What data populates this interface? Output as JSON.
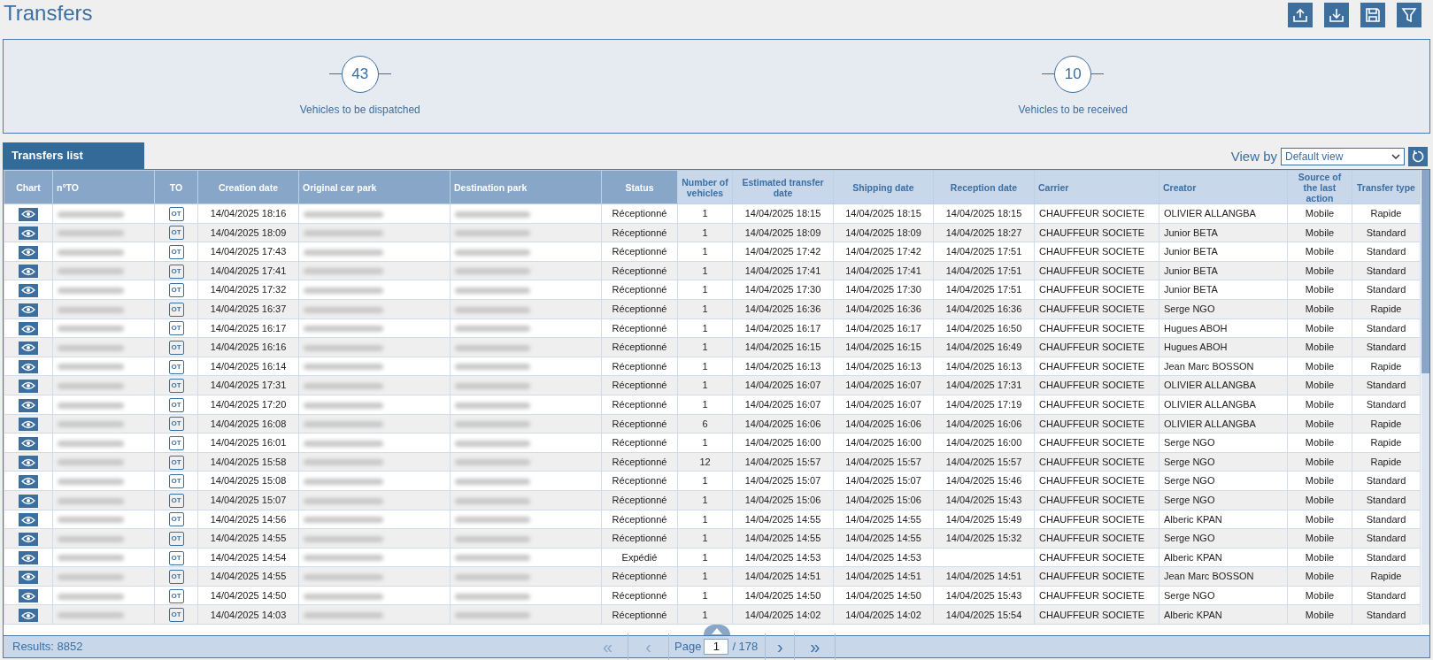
{
  "title": "Transfers",
  "summary": [
    {
      "count": "43",
      "label": "Vehicles to be dispatched"
    },
    {
      "count": "10",
      "label": "Vehicles to be received"
    }
  ],
  "list_tab": {
    "label": "Transfers list",
    "selected": true
  },
  "view_by": {
    "label": "View by",
    "value": "Default view"
  },
  "columns": [
    "Chart",
    "n°TO",
    "TO",
    "Creation date",
    "Original car park",
    "Destination park",
    "Status",
    "Number of vehicles",
    "Estimated transfer date",
    "Shipping date",
    "Reception date",
    "Carrier",
    "Creator",
    "Source of the last action",
    "Transfer type"
  ],
  "rows": [
    {
      "to_label": "OT",
      "creation": "14/04/2025 18:16",
      "status": "Réceptionné",
      "vehicles": "1",
      "estimated": "14/04/2025 18:15",
      "shipping": "14/04/2025 18:15",
      "reception": "14/04/2025 18:15",
      "carrier": "CHAUFFEUR SOCIETE",
      "creator": "OLIVIER ALLANGBA",
      "source": "Mobile",
      "type": "Rapide"
    },
    {
      "to_label": "OT",
      "creation": "14/04/2025 18:09",
      "status": "Réceptionné",
      "vehicles": "1",
      "estimated": "14/04/2025 18:09",
      "shipping": "14/04/2025 18:09",
      "reception": "14/04/2025 18:27",
      "carrier": "CHAUFFEUR SOCIETE",
      "creator": "Junior BETA",
      "source": "Mobile",
      "type": "Standard"
    },
    {
      "to_label": "OT",
      "creation": "14/04/2025 17:43",
      "status": "Réceptionné",
      "vehicles": "1",
      "estimated": "14/04/2025 17:42",
      "shipping": "14/04/2025 17:42",
      "reception": "14/04/2025 17:51",
      "carrier": "CHAUFFEUR SOCIETE",
      "creator": "Junior BETA",
      "source": "Mobile",
      "type": "Standard"
    },
    {
      "to_label": "OT",
      "creation": "14/04/2025 17:41",
      "status": "Réceptionné",
      "vehicles": "1",
      "estimated": "14/04/2025 17:41",
      "shipping": "14/04/2025 17:41",
      "reception": "14/04/2025 17:51",
      "carrier": "CHAUFFEUR SOCIETE",
      "creator": "Junior BETA",
      "source": "Mobile",
      "type": "Standard"
    },
    {
      "to_label": "OT",
      "creation": "14/04/2025 17:32",
      "status": "Réceptionné",
      "vehicles": "1",
      "estimated": "14/04/2025 17:30",
      "shipping": "14/04/2025 17:30",
      "reception": "14/04/2025 17:51",
      "carrier": "CHAUFFEUR SOCIETE",
      "creator": "Junior BETA",
      "source": "Mobile",
      "type": "Standard"
    },
    {
      "to_label": "OT",
      "creation": "14/04/2025 16:37",
      "status": "Réceptionné",
      "vehicles": "1",
      "estimated": "14/04/2025 16:36",
      "shipping": "14/04/2025 16:36",
      "reception": "14/04/2025 16:36",
      "carrier": "CHAUFFEUR SOCIETE",
      "creator": "Serge NGO",
      "source": "Mobile",
      "type": "Rapide"
    },
    {
      "to_label": "OT",
      "creation": "14/04/2025 16:17",
      "status": "Réceptionné",
      "vehicles": "1",
      "estimated": "14/04/2025 16:17",
      "shipping": "14/04/2025 16:17",
      "reception": "14/04/2025 16:50",
      "carrier": "CHAUFFEUR SOCIETE",
      "creator": "Hugues ABOH",
      "source": "Mobile",
      "type": "Standard"
    },
    {
      "to_label": "OT",
      "creation": "14/04/2025 16:16",
      "status": "Réceptionné",
      "vehicles": "1",
      "estimated": "14/04/2025 16:15",
      "shipping": "14/04/2025 16:15",
      "reception": "14/04/2025 16:49",
      "carrier": "CHAUFFEUR SOCIETE",
      "creator": "Hugues ABOH",
      "source": "Mobile",
      "type": "Standard"
    },
    {
      "to_label": "OT",
      "creation": "14/04/2025 16:14",
      "status": "Réceptionné",
      "vehicles": "1",
      "estimated": "14/04/2025 16:13",
      "shipping": "14/04/2025 16:13",
      "reception": "14/04/2025 16:13",
      "carrier": "CHAUFFEUR SOCIETE",
      "creator": "Jean Marc BOSSON",
      "source": "Mobile",
      "type": "Rapide"
    },
    {
      "to_label": "OT",
      "creation": "14/04/2025 17:31",
      "status": "Réceptionné",
      "vehicles": "1",
      "estimated": "14/04/2025 16:07",
      "shipping": "14/04/2025 16:07",
      "reception": "14/04/2025 17:31",
      "carrier": "CHAUFFEUR SOCIETE",
      "creator": "OLIVIER ALLANGBA",
      "source": "Mobile",
      "type": "Standard"
    },
    {
      "to_label": "OT",
      "creation": "14/04/2025 17:20",
      "status": "Réceptionné",
      "vehicles": "1",
      "estimated": "14/04/2025 16:07",
      "shipping": "14/04/2025 16:07",
      "reception": "14/04/2025 17:19",
      "carrier": "CHAUFFEUR SOCIETE",
      "creator": "OLIVIER ALLANGBA",
      "source": "Mobile",
      "type": "Standard"
    },
    {
      "to_label": "OT",
      "creation": "14/04/2025 16:08",
      "status": "Réceptionné",
      "vehicles": "6",
      "estimated": "14/04/2025 16:06",
      "shipping": "14/04/2025 16:06",
      "reception": "14/04/2025 16:06",
      "carrier": "CHAUFFEUR SOCIETE",
      "creator": "OLIVIER ALLANGBA",
      "source": "Mobile",
      "type": "Rapide"
    },
    {
      "to_label": "OT",
      "creation": "14/04/2025 16:01",
      "status": "Réceptionné",
      "vehicles": "1",
      "estimated": "14/04/2025 16:00",
      "shipping": "14/04/2025 16:00",
      "reception": "14/04/2025 16:00",
      "carrier": "CHAUFFEUR SOCIETE",
      "creator": "Serge NGO",
      "source": "Mobile",
      "type": "Rapide"
    },
    {
      "to_label": "OT",
      "creation": "14/04/2025 15:58",
      "status": "Réceptionné",
      "vehicles": "12",
      "estimated": "14/04/2025 15:57",
      "shipping": "14/04/2025 15:57",
      "reception": "14/04/2025 15:57",
      "carrier": "CHAUFFEUR SOCIETE",
      "creator": "Serge NGO",
      "source": "Mobile",
      "type": "Rapide"
    },
    {
      "to_label": "OT",
      "creation": "14/04/2025 15:08",
      "status": "Réceptionné",
      "vehicles": "1",
      "estimated": "14/04/2025 15:07",
      "shipping": "14/04/2025 15:07",
      "reception": "14/04/2025 15:46",
      "carrier": "CHAUFFEUR SOCIETE",
      "creator": "Serge NGO",
      "source": "Mobile",
      "type": "Standard"
    },
    {
      "to_label": "OT",
      "creation": "14/04/2025 15:07",
      "status": "Réceptionné",
      "vehicles": "1",
      "estimated": "14/04/2025 15:06",
      "shipping": "14/04/2025 15:06",
      "reception": "14/04/2025 15:43",
      "carrier": "CHAUFFEUR SOCIETE",
      "creator": "Serge NGO",
      "source": "Mobile",
      "type": "Standard"
    },
    {
      "to_label": "OT",
      "creation": "14/04/2025 14:56",
      "status": "Réceptionné",
      "vehicles": "1",
      "estimated": "14/04/2025 14:55",
      "shipping": "14/04/2025 14:55",
      "reception": "14/04/2025 15:49",
      "carrier": "CHAUFFEUR SOCIETE",
      "creator": "Alberic KPAN",
      "source": "Mobile",
      "type": "Standard"
    },
    {
      "to_label": "OT",
      "creation": "14/04/2025 14:55",
      "status": "Réceptionné",
      "vehicles": "1",
      "estimated": "14/04/2025 14:55",
      "shipping": "14/04/2025 14:55",
      "reception": "14/04/2025 15:32",
      "carrier": "CHAUFFEUR SOCIETE",
      "creator": "Serge NGO",
      "source": "Mobile",
      "type": "Standard"
    },
    {
      "to_label": "OT",
      "creation": "14/04/2025 14:54",
      "status": "Expédié",
      "vehicles": "1",
      "estimated": "14/04/2025 14:53",
      "shipping": "14/04/2025 14:53",
      "carrier": "CHAUFFEUR SOCIETE",
      "creator": "Alberic KPAN",
      "source": "Mobile",
      "type": "Standard"
    },
    {
      "to_label": "OT",
      "creation": "14/04/2025 14:55",
      "status": "Réceptionné",
      "vehicles": "1",
      "estimated": "14/04/2025 14:51",
      "shipping": "14/04/2025 14:51",
      "reception": "14/04/2025 14:51",
      "carrier": "CHAUFFEUR SOCIETE",
      "creator": "Jean Marc BOSSON",
      "source": "Mobile",
      "type": "Rapide"
    },
    {
      "to_label": "OT",
      "creation": "14/04/2025 14:50",
      "status": "Réceptionné",
      "vehicles": "1",
      "estimated": "14/04/2025 14:50",
      "shipping": "14/04/2025 14:50",
      "reception": "14/04/2025 15:43",
      "carrier": "CHAUFFEUR SOCIETE",
      "creator": "Serge NGO",
      "source": "Mobile",
      "type": "Standard"
    },
    {
      "to_label": "OT",
      "creation": "14/04/2025 14:03",
      "status": "Réceptionné",
      "vehicles": "1",
      "estimated": "14/04/2025 14:02",
      "shipping": "14/04/2025 14:02",
      "reception": "14/04/2025 15:54",
      "carrier": "CHAUFFEUR SOCIETE",
      "creator": "Alberic KPAN",
      "source": "Mobile",
      "type": "Standard"
    }
  ],
  "footer": {
    "results": "Results: 8852",
    "first": "«",
    "prev": "‹",
    "page_label": "Page",
    "page": "1",
    "of": "/ 178",
    "next": "›",
    "last": "»"
  }
}
